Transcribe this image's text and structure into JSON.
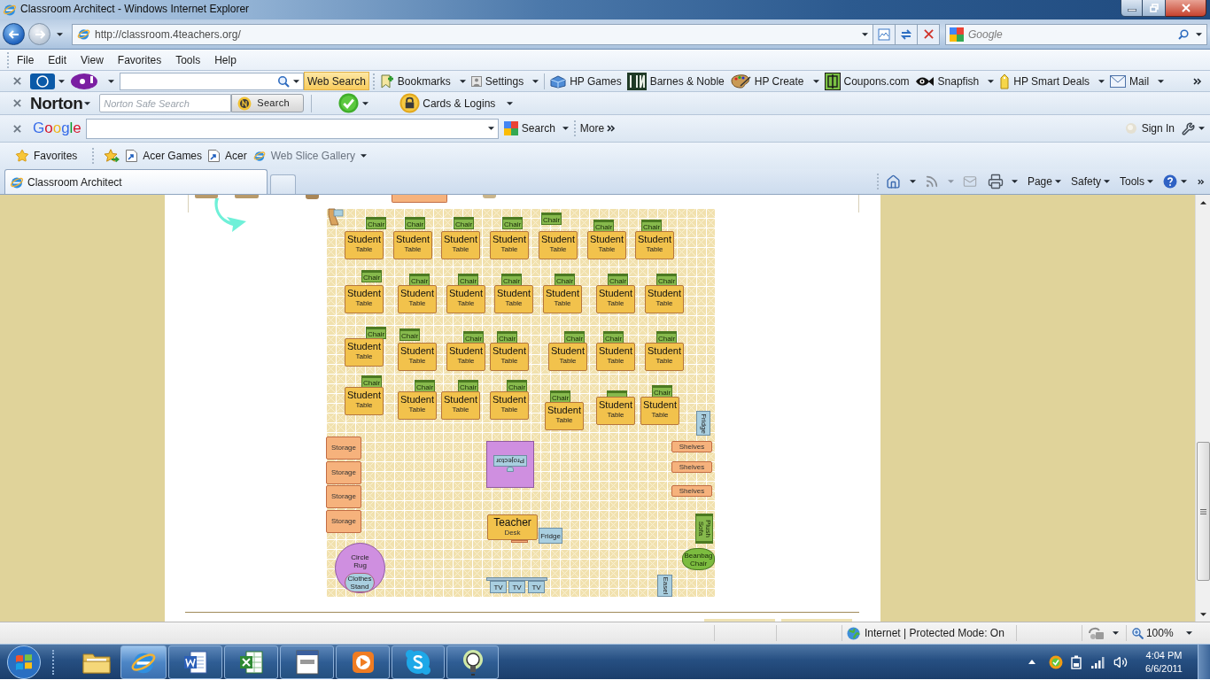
{
  "window": {
    "title": "Classroom Architect - Windows Internet Explorer"
  },
  "address_bar": {
    "url": "http://classroom.4teachers.org/"
  },
  "search_box": {
    "placeholder": "Google"
  },
  "menu_bar": {
    "items": [
      "File",
      "Edit",
      "View",
      "Favorites",
      "Tools",
      "Help"
    ]
  },
  "yahoo_toolbar": {
    "search_button": "Web Search",
    "items": [
      {
        "label": "Bookmarks",
        "dropdown": true
      },
      {
        "label": "Settings",
        "dropdown": true
      },
      {
        "label": "HP Games",
        "dropdown": false
      },
      {
        "label": "Barnes & Noble",
        "dropdown": false
      },
      {
        "label": "HP Create",
        "dropdown": true
      },
      {
        "label": "Coupons.com",
        "dropdown": false
      },
      {
        "label": "Snapfish",
        "dropdown": true
      },
      {
        "label": "HP Smart Deals",
        "dropdown": true
      },
      {
        "label": "Mail",
        "dropdown": true
      }
    ]
  },
  "norton_toolbar": {
    "logo": "Norton",
    "placeholder": "Norton Safe Search",
    "search_button": "Search",
    "vault_button": "Cards & Logins"
  },
  "google_toolbar": {
    "logo": "Google",
    "search_button": "Search",
    "more_button": "More",
    "sign_in": "Sign In"
  },
  "favorites_bar": {
    "favorites": "Favorites",
    "links": [
      {
        "label": "Acer Games",
        "dropdown": false
      },
      {
        "label": "Acer",
        "dropdown": false
      },
      {
        "label": "Web Slice Gallery",
        "dropdown": true
      }
    ]
  },
  "tabs": [
    {
      "label": "Classroom Architect",
      "selected": true
    }
  ],
  "command_bar": {
    "menus": [
      "Page",
      "Safety",
      "Tools"
    ]
  },
  "classroom": {
    "student_tables": [
      {
        "name": "Student",
        "type": "Table",
        "chair": "Chair"
      },
      {
        "name": "Student",
        "type": "Table",
        "chair": "Chair"
      },
      {
        "name": "Student",
        "type": "Table",
        "chair": "Chair"
      },
      {
        "name": "Student",
        "type": "Table",
        "chair": "Chair"
      },
      {
        "name": "Student",
        "type": "Table",
        "chair": "Chair"
      },
      {
        "name": "Student",
        "type": "Table",
        "chair": "Chair"
      },
      {
        "name": "Student",
        "type": "Table",
        "chair": "Chair"
      },
      {
        "name": "Student",
        "type": "Table",
        "chair": "Chair"
      },
      {
        "name": "Student",
        "type": "Table",
        "chair": "Chair"
      },
      {
        "name": "Student",
        "type": "Table",
        "chair": "Chair"
      },
      {
        "name": "Student",
        "type": "Table",
        "chair": "Chair"
      },
      {
        "name": "Student",
        "type": "Table",
        "chair": "Chair"
      },
      {
        "name": "Student",
        "type": "Table",
        "chair": "Chair"
      },
      {
        "name": "Student",
        "type": "Table",
        "chair": "Chair"
      },
      {
        "name": "Student",
        "type": "Table",
        "chair": "Chair"
      },
      {
        "name": "Student",
        "type": "Table",
        "chair": "Chair"
      },
      {
        "name": "Student",
        "type": "Table",
        "chair": "Chair"
      },
      {
        "name": "Student",
        "type": "Table",
        "chair": "Chair"
      },
      {
        "name": "Student",
        "type": "Table",
        "chair": "Chair"
      },
      {
        "name": "Student",
        "type": "Table",
        "chair": "Chair"
      },
      {
        "name": "Student",
        "type": "Table",
        "chair": "Chair"
      },
      {
        "name": "Student",
        "type": "Table",
        "chair": "Chair"
      },
      {
        "name": "Student",
        "type": "Table",
        "chair": "Chair"
      },
      {
        "name": "Student",
        "type": "Table",
        "chair": "Chair"
      },
      {
        "name": "Student",
        "type": "Table",
        "chair": "Chair"
      },
      {
        "name": "Student",
        "type": "Table",
        "chair": "Chair"
      },
      {
        "name": "Student",
        "type": "Table"
      },
      {
        "name": "Student",
        "type": "Table",
        "chair": "Chair"
      }
    ],
    "storage": [
      "Storage",
      "Storage",
      "Storage",
      "Storage"
    ],
    "shelves": [
      "Shelves",
      "Shelves",
      "Shelves"
    ],
    "projector": "Projector",
    "teacher_desk": {
      "name": "Teacher",
      "type": "Desk"
    },
    "fridges": [
      "Fridge",
      "Fridge"
    ],
    "sofa": "Plush Sofa",
    "beanbag": "Beanbag Chair",
    "circle_rug": "Circle Rug",
    "clothes_stand": "Clothes Stand",
    "tvs": [
      "TV",
      "TV",
      "TV"
    ],
    "easel": "Easel"
  },
  "status_bar": {
    "zone": "Internet | Protected Mode: On",
    "zoom": "100%"
  },
  "taskbar": {
    "apps": [
      {
        "running": false,
        "selected": false
      },
      {
        "running": true,
        "selected": true
      },
      {
        "running": true,
        "selected": false
      },
      {
        "running": true,
        "selected": false
      },
      {
        "running": true,
        "selected": false
      },
      {
        "running": true,
        "selected": false
      },
      {
        "running": true,
        "selected": false
      },
      {
        "running": true,
        "selected": false
      }
    ],
    "clock": {
      "time": "4:04 PM",
      "date": "6/6/2011"
    }
  }
}
